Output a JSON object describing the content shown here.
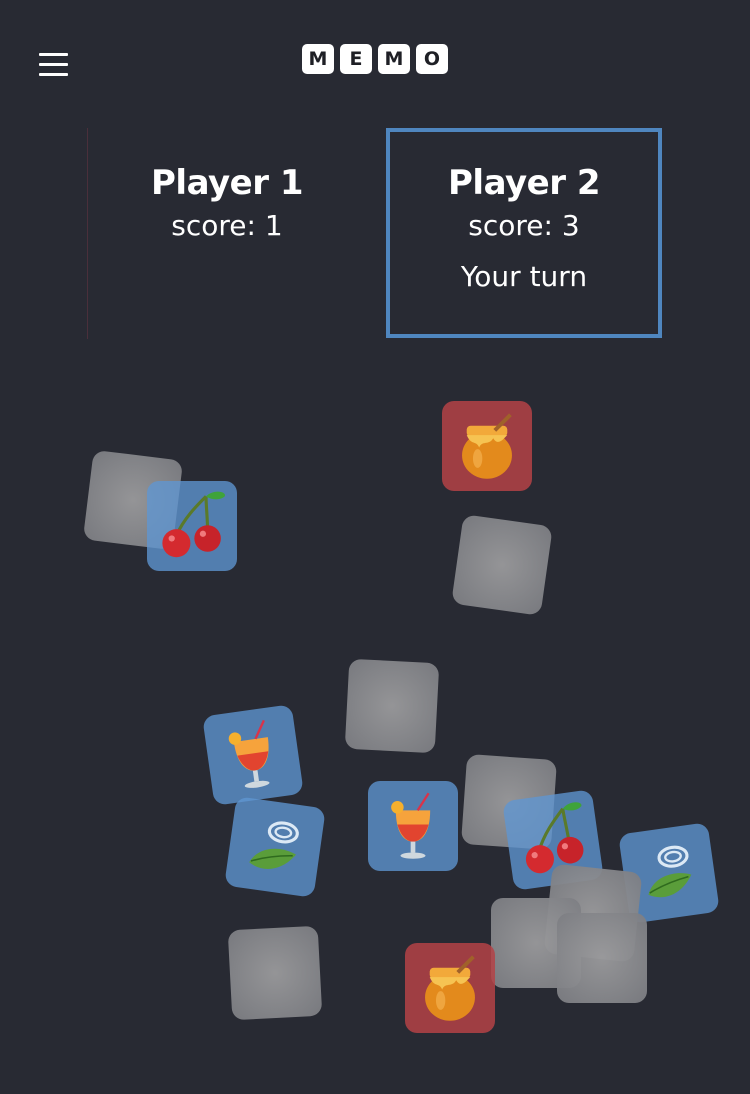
{
  "app": {
    "logo_letters": [
      "M",
      "E",
      "M",
      "O"
    ]
  },
  "players": [
    {
      "name": "Player 1",
      "score_text": "score: 1",
      "turn_text": "",
      "active": false
    },
    {
      "name": "Player 2",
      "score_text": "score: 3",
      "turn_text": "Your turn",
      "active": true
    }
  ],
  "theme": {
    "background": "#282a33",
    "active_border": "#4f86bf",
    "revealed_blue": "#5f96d2",
    "matched_red": "#b44246",
    "hidden_tile": "#85868a"
  },
  "cards": [
    {
      "state": "hidden"
    },
    {
      "state": "revealed",
      "icon": "cherries-icon",
      "color": "blue"
    },
    {
      "state": "matched",
      "icon": "honey-pot-icon",
      "color": "red"
    },
    {
      "state": "hidden"
    },
    {
      "state": "hidden"
    },
    {
      "state": "revealed",
      "icon": "tropical-drink-icon",
      "color": "blue"
    },
    {
      "state": "revealed",
      "icon": "herb-icon",
      "color": "blue"
    },
    {
      "state": "revealed",
      "icon": "tropical-drink-icon",
      "color": "blue"
    },
    {
      "state": "hidden"
    },
    {
      "state": "revealed",
      "icon": "cherries-icon",
      "color": "blue"
    },
    {
      "state": "revealed",
      "icon": "herb-icon",
      "color": "blue"
    },
    {
      "state": "hidden"
    },
    {
      "state": "hidden"
    },
    {
      "state": "hidden"
    },
    {
      "state": "hidden"
    },
    {
      "state": "matched",
      "icon": "honey-pot-icon",
      "color": "red"
    }
  ]
}
